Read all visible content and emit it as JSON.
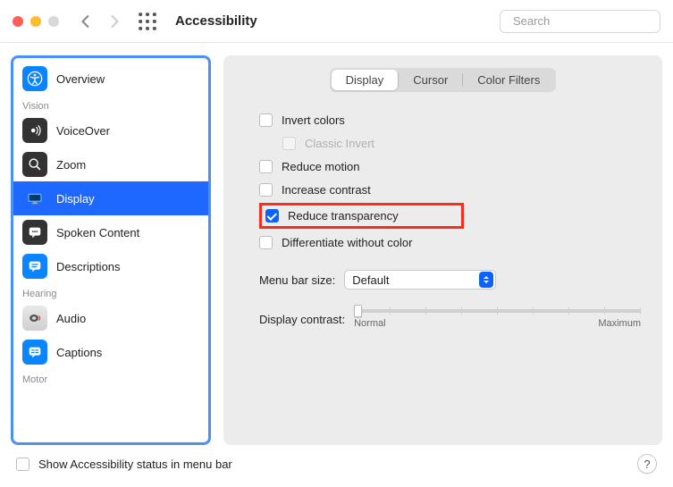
{
  "window": {
    "title": "Accessibility"
  },
  "search": {
    "placeholder": "Search"
  },
  "sidebar": {
    "sections": {
      "vision": "Vision",
      "hearing": "Hearing",
      "motor": "Motor"
    },
    "items": {
      "overview": "Overview",
      "voiceover": "VoiceOver",
      "zoom": "Zoom",
      "display": "Display",
      "spoken": "Spoken Content",
      "descriptions": "Descriptions",
      "audio": "Audio",
      "captions": "Captions"
    }
  },
  "tabs": {
    "display": "Display",
    "cursor": "Cursor",
    "filters": "Color Filters"
  },
  "options": {
    "invert": "Invert colors",
    "classic_invert": "Classic Invert",
    "reduce_motion": "Reduce motion",
    "increase_contrast": "Increase contrast",
    "reduce_transparency": "Reduce transparency",
    "diff_color": "Differentiate without color"
  },
  "menu_bar": {
    "label": "Menu bar size:",
    "value": "Default"
  },
  "contrast": {
    "label": "Display contrast:",
    "min": "Normal",
    "max": "Maximum"
  },
  "footer": {
    "show_status": "Show Accessibility status in menu bar"
  }
}
